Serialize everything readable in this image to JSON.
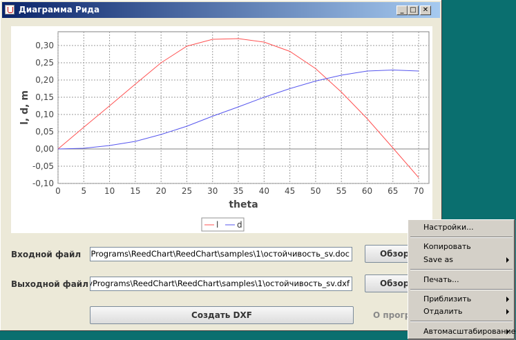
{
  "window": {
    "title": "Диаграмма Рида"
  },
  "chart_data": {
    "type": "line",
    "xlabel": "theta",
    "ylabel": "l, d, m",
    "xlim": [
      0,
      72
    ],
    "ylim": [
      -0.1,
      0.34
    ],
    "x_ticks": [
      "0",
      "5",
      "10",
      "15",
      "20",
      "25",
      "30",
      "35",
      "40",
      "45",
      "50",
      "55",
      "60",
      "65",
      "70"
    ],
    "y_ticks": [
      "0,30",
      "0,25",
      "0,20",
      "0,15",
      "0,10",
      "0,05",
      "0,00",
      "-0,05",
      "-0,10"
    ],
    "x": [
      0,
      5,
      10,
      15,
      20,
      25,
      30,
      35,
      40,
      45,
      50,
      55,
      60,
      65,
      70
    ],
    "series": [
      {
        "name": "l",
        "color": "#ff5050",
        "values": [
          0.0,
          0.063,
          0.125,
          0.188,
          0.25,
          0.298,
          0.318,
          0.32,
          0.31,
          0.283,
          0.233,
          0.165,
          0.088,
          0.003,
          -0.083
        ]
      },
      {
        "name": "d",
        "color": "#5555ee",
        "values": [
          0.0,
          0.002,
          0.01,
          0.022,
          0.042,
          0.066,
          0.095,
          0.122,
          0.15,
          0.175,
          0.197,
          0.214,
          0.226,
          0.229,
          0.226
        ]
      }
    ],
    "legend_position": "bottom-center",
    "grid": true
  },
  "form": {
    "input_label": "Входной файл",
    "input_value": "\\MyPrograms\\ReedChart\\ReedChart\\samples\\1\\остойчивость_sv.doc",
    "browse1_label": "Обзор...",
    "output_label": "Выходной файл",
    "output_value": "\\MyPrograms\\ReedChart\\ReedChart\\samples\\1\\остойчивость_sv.dxf",
    "browse2_label": "Обзор...",
    "create_label": "Создать DXF",
    "about_label": "О программе"
  },
  "context_menu": {
    "settings": "Настройки...",
    "copy": "Копировать",
    "save_as": "Save as",
    "print": "Печать...",
    "zoom_in": "Приблизить",
    "zoom_out": "Отдалить",
    "autoscale": "Автомасштабирование"
  }
}
